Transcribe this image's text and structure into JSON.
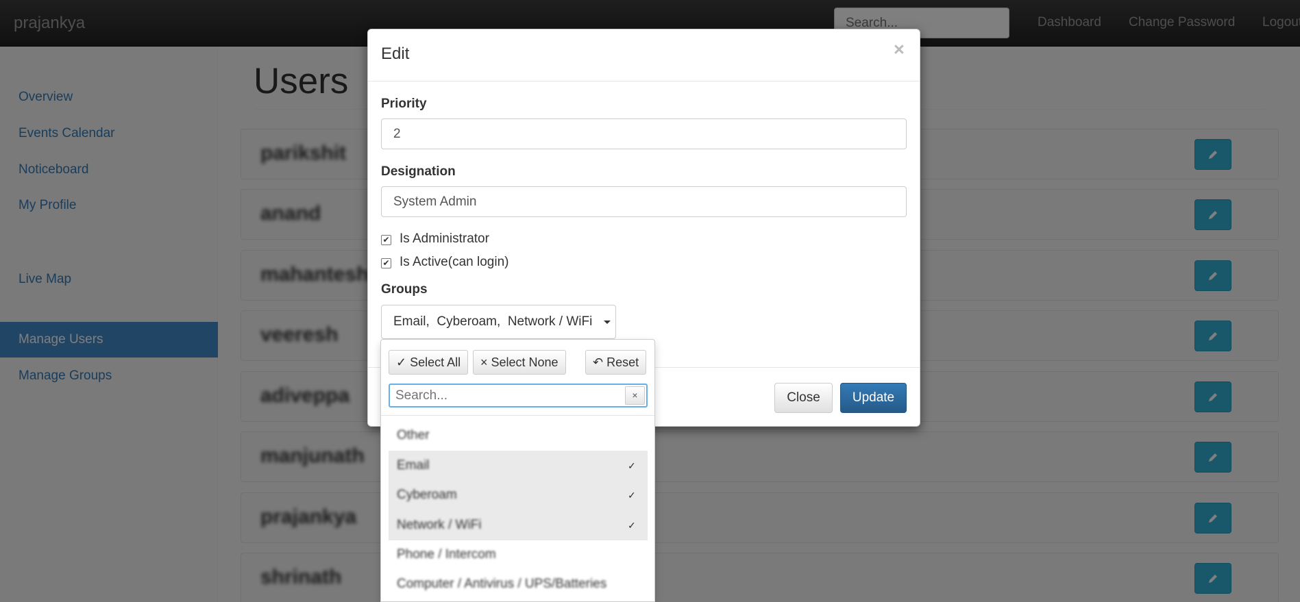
{
  "navbar": {
    "brand": "prajankya",
    "search_placeholder": "Search...",
    "links": [
      "Dashboard",
      "Change Password",
      "Logout"
    ]
  },
  "sidebar": {
    "items": [
      {
        "label": "Overview"
      },
      {
        "label": "Events Calendar"
      },
      {
        "label": "Noticeboard"
      },
      {
        "label": "My Profile"
      },
      {
        "label": "Live Map"
      },
      {
        "label": "Manage Users",
        "active": true
      },
      {
        "label": "Manage Groups"
      }
    ]
  },
  "main": {
    "title": "Users",
    "users": [
      "parikshit",
      "anand",
      "mahantesh",
      "veeresh",
      "adiveppa",
      "manjunath",
      "prajankya",
      "shrinath"
    ]
  },
  "modal": {
    "title": "Edit",
    "close_glyph": "×",
    "priority_label": "Priority",
    "priority_value": "2",
    "designation_label": "Designation",
    "designation_value": "System Admin",
    "is_admin_label": "Is Administrator",
    "is_admin_checked": true,
    "is_active_label": "Is Active(can login)",
    "is_active_checked": true,
    "groups_label": "Groups",
    "groups_value": "Email,  Cyberoam,  Network / WiFi",
    "close_button": "Close",
    "update_button": "Update"
  },
  "dropdown": {
    "select_all": "✓  Select All",
    "select_none": "×  Select None",
    "reset": "↶  Reset",
    "search_placeholder": "Search...",
    "clear_glyph": "×",
    "options": [
      {
        "label": "Other",
        "selected": false
      },
      {
        "label": "Email",
        "selected": true
      },
      {
        "label": "Cyberoam",
        "selected": true
      },
      {
        "label": "Network / WiFi",
        "selected": true
      },
      {
        "label": "Phone / Intercom",
        "selected": false
      },
      {
        "label": "Computer / Antivirus / UPS/Batteries",
        "selected": false
      }
    ],
    "check_glyph": "✓"
  },
  "colors": {
    "accent": "#337ab7",
    "active_sidebar": "#428bca",
    "edit_button": "#31b0d5"
  }
}
